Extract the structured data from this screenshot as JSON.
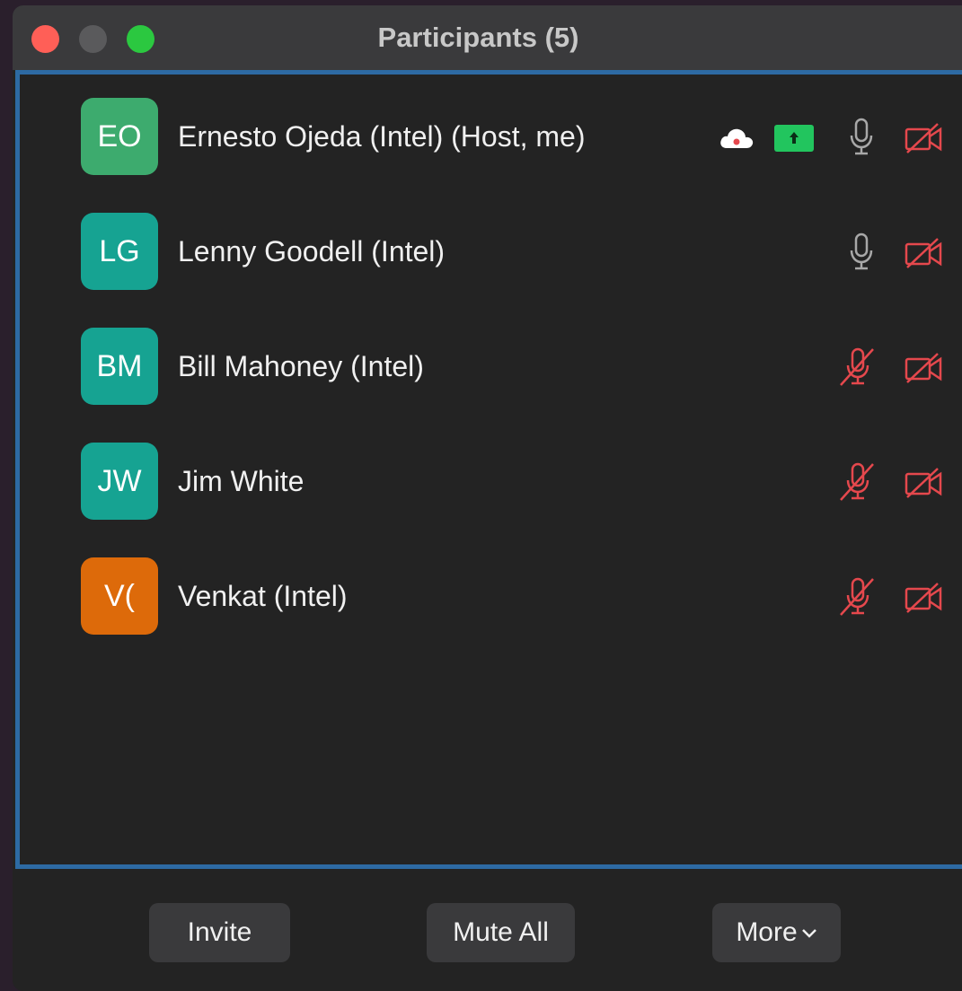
{
  "window": {
    "title": "Participants (5)"
  },
  "participants": [
    {
      "initials": "EO",
      "name": "Ernesto Ojeda (Intel) (Host, me)",
      "avatar_color": "#3dab6e",
      "recording": true,
      "sharing": true,
      "mic": "on",
      "video": "off"
    },
    {
      "initials": "LG",
      "name": "Lenny Goodell (Intel)",
      "avatar_color": "#16a392",
      "mic": "on",
      "video": "off"
    },
    {
      "initials": "BM",
      "name": "Bill Mahoney (Intel)",
      "avatar_color": "#16a392",
      "mic": "muted",
      "video": "off"
    },
    {
      "initials": "JW",
      "name": "Jim White",
      "avatar_color": "#16a392",
      "mic": "muted",
      "video": "off"
    },
    {
      "initials": "V(",
      "name": "Venkat (Intel)",
      "avatar_color": "#dd6a0a",
      "mic": "muted",
      "video": "off"
    }
  ],
  "footer": {
    "invite_label": "Invite",
    "mute_all_label": "Mute All",
    "more_label": "More"
  },
  "colors": {
    "accent_border": "#2d6aa3",
    "muted_red": "#e5484d",
    "share_green": "#22c55e"
  }
}
